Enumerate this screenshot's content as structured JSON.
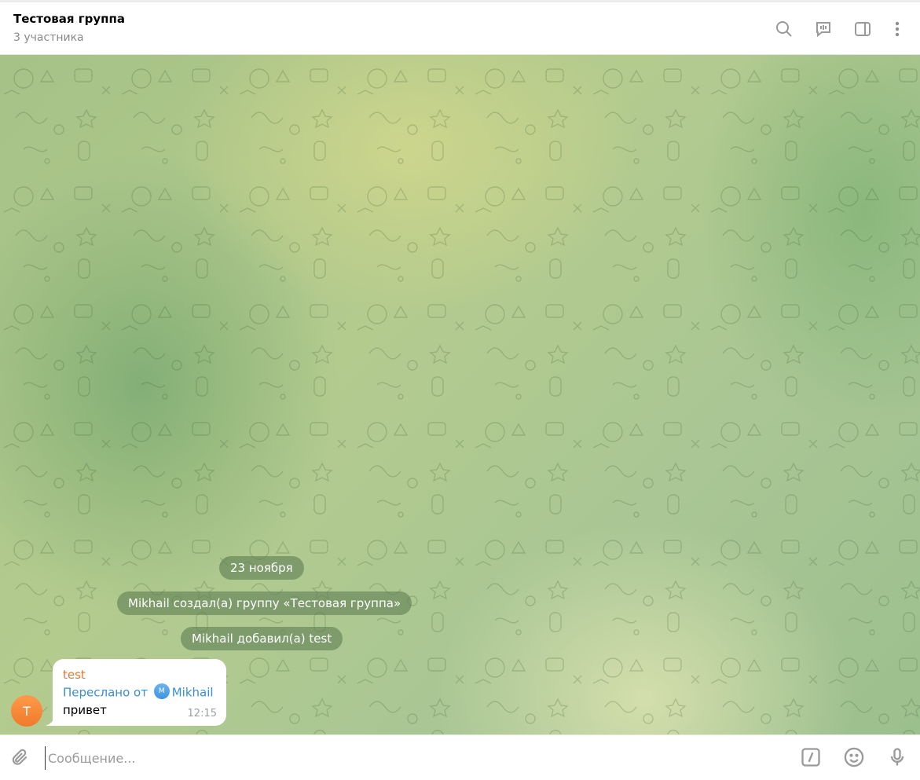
{
  "header": {
    "title": "Тестовая группа",
    "subtitle": "3 участника",
    "icons": [
      "search-icon",
      "voice-chat-icon",
      "sidebar-toggle-icon",
      "more-vertical-icon"
    ]
  },
  "chat": {
    "date_label": "23 ноября",
    "service_messages": [
      "Mikhail создал(а) группу «Тестовая группа»",
      "Mikhail добавил(а) test"
    ],
    "message": {
      "avatar_letter": "T",
      "sender": "test",
      "forwarded_prefix": "Переслано от",
      "forwarded_avatar_letter": "M",
      "forwarded_from": "Mikhail",
      "text": "привет",
      "time": "12:15"
    }
  },
  "composer": {
    "placeholder": "Сообщение...",
    "value": "",
    "icons": [
      "attach-icon",
      "commands-icon",
      "emoji-icon",
      "microphone-icon"
    ]
  },
  "colors": {
    "sender": "#e07a2c",
    "forwarded": "#3a8fd0",
    "avatar": "#f58a3a"
  }
}
